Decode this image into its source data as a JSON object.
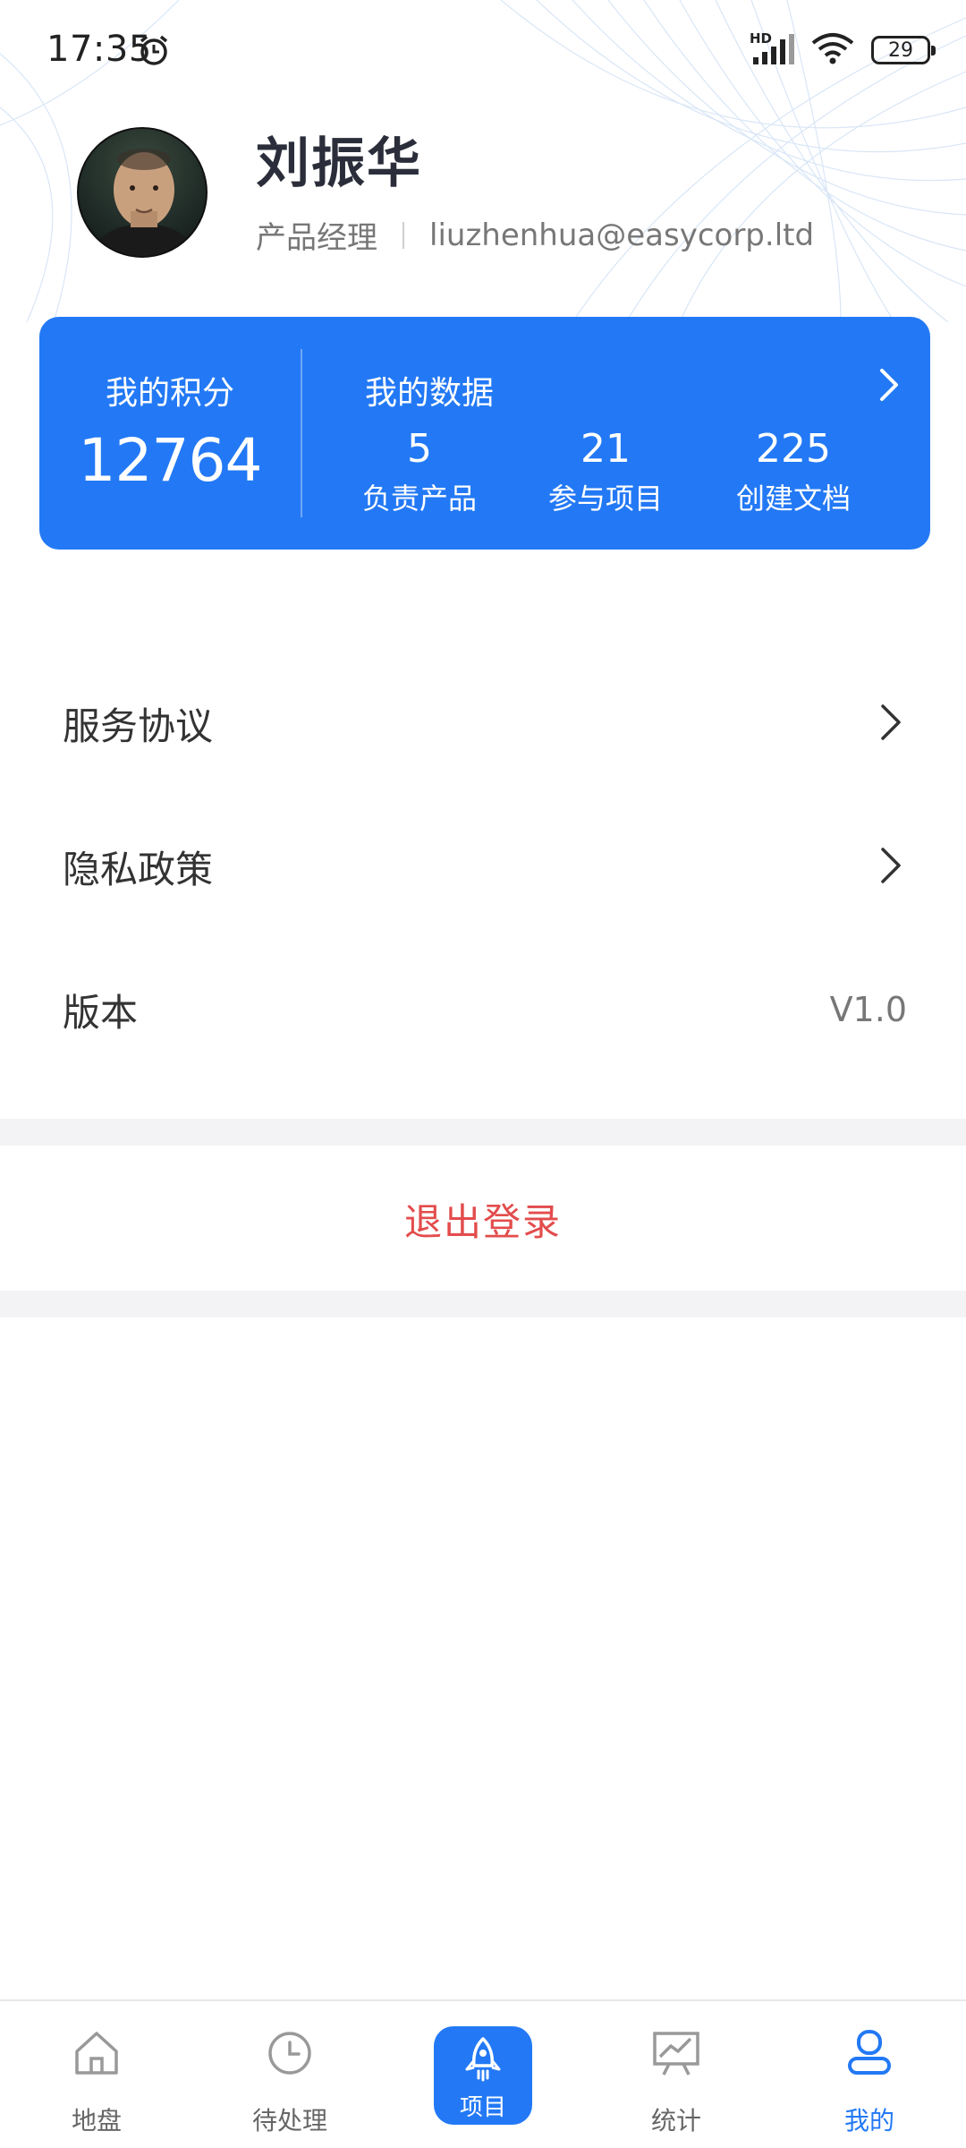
{
  "status_bar": {
    "time": "17:35",
    "network": "HD",
    "battery": "29"
  },
  "profile": {
    "name": "刘振华",
    "role": "产品经理",
    "email": "liuzhenhua@easycorp.ltd"
  },
  "stats": {
    "points_label": "我的积分",
    "points_value": "12764",
    "my_data_title": "我的数据",
    "items": [
      {
        "value": "5",
        "label": "负责产品"
      },
      {
        "value": "21",
        "label": "参与项目"
      },
      {
        "value": "225",
        "label": "创建文档"
      }
    ]
  },
  "menu": {
    "service_agreement": "服务协议",
    "privacy_policy": "隐私政策",
    "version_label": "版本",
    "version_value": "V1.0"
  },
  "logout": "退出登录",
  "tabbar": {
    "tabs": [
      {
        "label": "地盘",
        "icon": "home-icon"
      },
      {
        "label": "待处理",
        "icon": "clock-icon"
      },
      {
        "label": "项目",
        "icon": "rocket-icon"
      },
      {
        "label": "统计",
        "icon": "chart-icon"
      },
      {
        "label": "我的",
        "icon": "user-icon"
      }
    ],
    "active": "我的"
  },
  "colors": {
    "accent": "#2379f5",
    "logout": "#e34c4c",
    "title": "#2b2e3a"
  }
}
